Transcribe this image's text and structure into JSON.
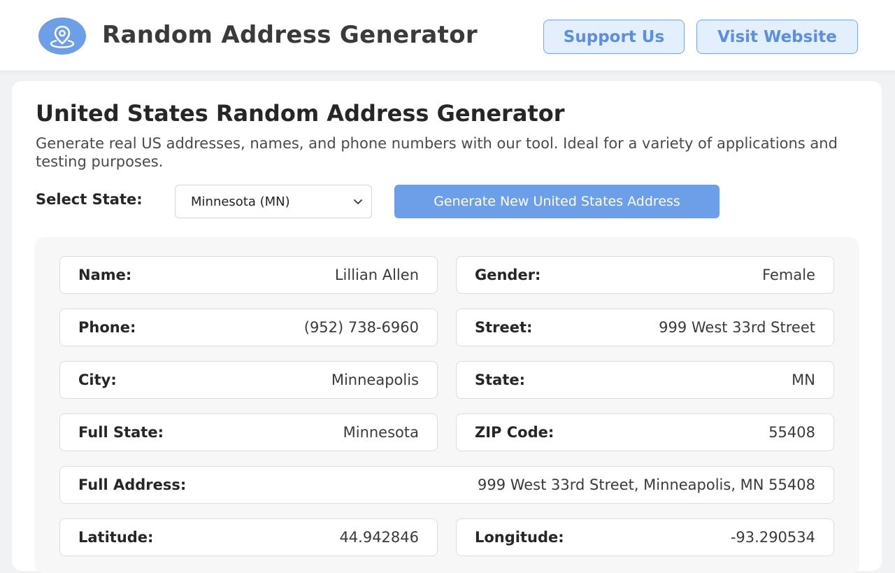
{
  "header": {
    "title": "Random Address Generator",
    "support_label": "Support Us",
    "visit_label": "Visit Website",
    "logo_icon": "location-pin-icon",
    "accent_color": "#6d9fe8"
  },
  "main": {
    "title": "United States Random Address Generator",
    "description": "Generate real US addresses, names, and phone numbers with our tool. Ideal for a variety of applications and testing purposes.",
    "state_label": "Select State:",
    "state_selected": "Minnesota (MN)",
    "generate_label": "Generate New United States Address"
  },
  "result": {
    "name": {
      "label": "Name:",
      "value": "Lillian Allen"
    },
    "gender": {
      "label": "Gender:",
      "value": "Female"
    },
    "phone": {
      "label": "Phone:",
      "value": "(952) 738-6960"
    },
    "street": {
      "label": "Street:",
      "value": "999 West 33rd Street"
    },
    "city": {
      "label": "City:",
      "value": "Minneapolis"
    },
    "state": {
      "label": "State:",
      "value": "MN"
    },
    "full_state": {
      "label": "Full State:",
      "value": "Minnesota"
    },
    "zip": {
      "label": "ZIP Code:",
      "value": "55408"
    },
    "full_address": {
      "label": "Full Address:",
      "value": "999 West 33rd Street, Minneapolis, MN 55408"
    },
    "latitude": {
      "label": "Latitude:",
      "value": "44.942846"
    },
    "longitude": {
      "label": "Longitude:",
      "value": "-93.290534"
    }
  }
}
